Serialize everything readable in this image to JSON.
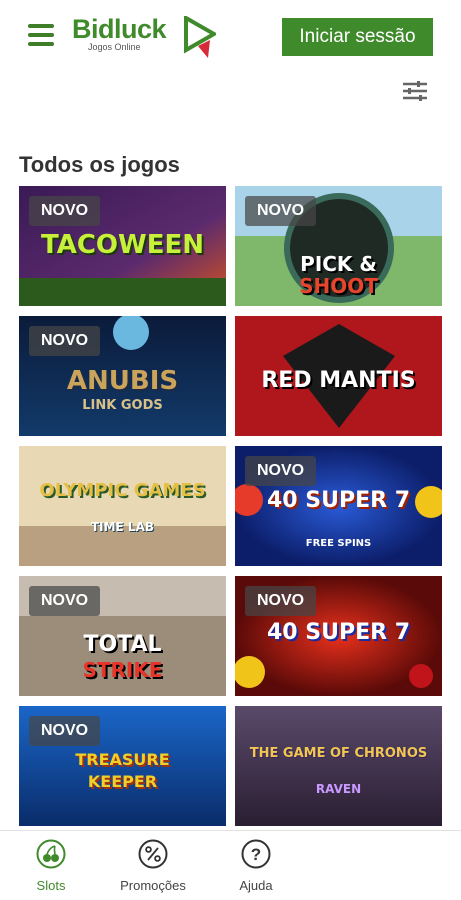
{
  "header": {
    "logo_text": "Bidluck",
    "logo_sub": "Jogos Online",
    "login_label": "Iniciar sessão"
  },
  "section": {
    "title": "Todos os jogos"
  },
  "games": [
    {
      "title_line1": "TACOWEEN",
      "title_line2": "",
      "badge": "NOVO"
    },
    {
      "title_line1": "PICK &",
      "title_line2": "SHOOT",
      "badge": "NOVO"
    },
    {
      "title_line1": "ANUBIS",
      "title_line2": "LINK GODS",
      "badge": "NOVO"
    },
    {
      "title_line1": "RED MANTIS",
      "title_line2": "",
      "badge": ""
    },
    {
      "title_line1": "OLYMPIC GAMES",
      "title_line2": "TIME LAB",
      "badge": ""
    },
    {
      "title_line1": "40 SUPER 7",
      "title_line2": "FREE SPINS",
      "badge": "NOVO"
    },
    {
      "title_line1": "TOTAL",
      "title_line2": "STRIKE",
      "badge": "NOVO"
    },
    {
      "title_line1": "40 SUPER 7",
      "title_line2": "",
      "badge": "NOVO"
    },
    {
      "title_line1": "TREASURE",
      "title_line2": "KEEPER",
      "badge": "NOVO"
    },
    {
      "title_line1": "THE GAME OF CHRONOS",
      "title_line2": "RAVEN",
      "badge": ""
    }
  ],
  "bottom_nav": {
    "items": [
      {
        "label": "Slots",
        "icon": "cherries-icon",
        "active": true
      },
      {
        "label": "Promoções",
        "icon": "percent-icon",
        "active": false
      },
      {
        "label": "Ajuda",
        "icon": "question-icon",
        "active": false
      }
    ]
  },
  "colors": {
    "brand": "#3f8a2b",
    "badge_bg": "#464646"
  }
}
